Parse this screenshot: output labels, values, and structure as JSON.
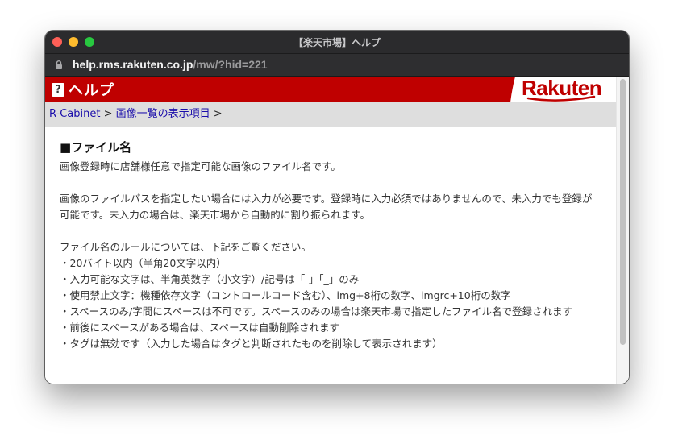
{
  "window": {
    "title": "【楽天市場】ヘルプ"
  },
  "address_bar": {
    "domain": "help.rms.rakuten.co.jp",
    "path": "/mw/?hid=221"
  },
  "header": {
    "icon_glyph": "?",
    "title": "ヘルプ",
    "logo": "Rakuten"
  },
  "breadcrumb": {
    "items": [
      {
        "label": "R-Cabinet"
      },
      {
        "label": "画像一覧の表示項目"
      }
    ],
    "separator": ">"
  },
  "article": {
    "heading": "■ファイル名",
    "paragraphs": [
      "画像登録時に店舗様任意で指定可能な画像のファイル名です。",
      "画像のファイルパスを指定したい場合には入力が必要です。登録時に入力必須ではありませんので、未入力でも登録が可能です。未入力の場合は、楽天市場から自動的に割り振られます。"
    ],
    "rules_intro": "ファイル名のルールについては、下記をご覧ください。",
    "rules": [
      "・20バイト以内（半角20文字以内）",
      "・入力可能な文字は、半角英数字（小文字）/記号は「-」「_」のみ",
      "・使用禁止文字：機種依存文字（コントロールコード含む）、img+8桁の数字、imgrc+10桁の数字",
      "・スペースのみ/字間にスペースは不可です。スペースのみの場合は楽天市場で指定したファイル名で登録されます",
      "・前後にスペースがある場合は、スペースは自動削除されます",
      "・タグは無効です（入力した場合はタグと判断されたものを削除して表示されます）"
    ]
  },
  "colors": {
    "brand_red": "#bf0000",
    "titlebar": "#2b2b2d",
    "link": "#1a0dab"
  },
  "icons": [
    "lock-icon",
    "help-question-icon",
    "close-button",
    "minimize-button",
    "zoom-button"
  ]
}
